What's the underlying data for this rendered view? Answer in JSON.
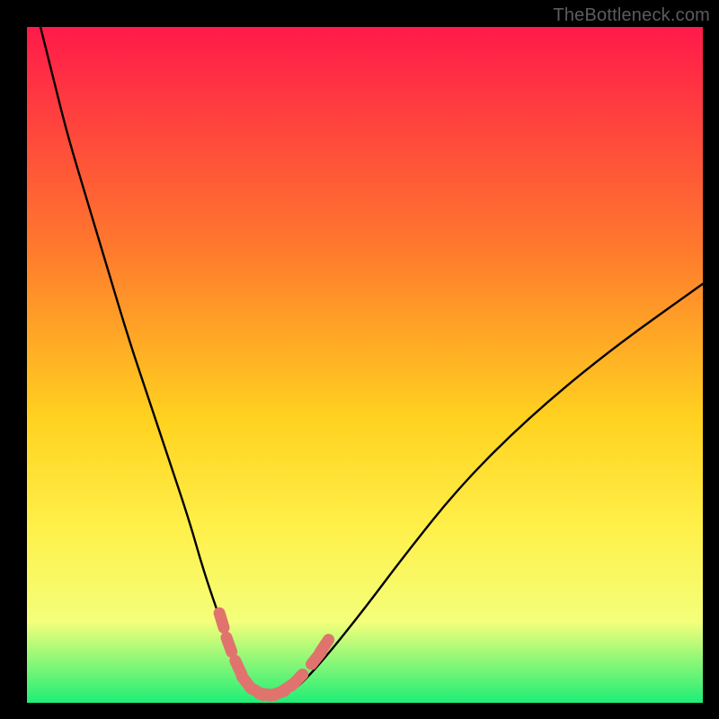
{
  "watermark": "TheBottleneck.com",
  "colors": {
    "frame": "#000000",
    "gradient_top": "#ff1a4a",
    "gradient_mid1": "#ff7a2d",
    "gradient_mid2": "#ffd21f",
    "gradient_mid3": "#fff04a",
    "gradient_mid4": "#f4ff7a",
    "gradient_bottom": "#1eee76",
    "curve": "#000000",
    "marker_fill": "#e0736e",
    "marker_stroke": "#c85a56"
  },
  "chart_data": {
    "type": "line",
    "title": "",
    "xlabel": "",
    "ylabel": "",
    "xlim": [
      0,
      100
    ],
    "ylim": [
      0,
      100
    ],
    "series": [
      {
        "name": "bottleneck-curve",
        "x": [
          2,
          4,
          6,
          9,
          12,
          15,
          18,
          21,
          24,
          26,
          28,
          30,
          31.5,
          33,
          34.5,
          36,
          38,
          40,
          44,
          50,
          56,
          64,
          74,
          86,
          100
        ],
        "y": [
          100,
          92,
          84,
          74,
          64,
          54,
          45,
          36,
          27,
          20,
          14,
          8.5,
          5,
          2.6,
          1.4,
          1.2,
          1.3,
          2.2,
          6.5,
          14,
          22,
          32,
          42,
          52,
          62
        ]
      }
    ],
    "markers": [
      {
        "x": 28.8,
        "y": 12.2
      },
      {
        "x": 29.9,
        "y": 8.6
      },
      {
        "x": 31.3,
        "y": 5.2
      },
      {
        "x": 32.5,
        "y": 3.0
      },
      {
        "x": 34.0,
        "y": 1.7
      },
      {
        "x": 35.5,
        "y": 1.25
      },
      {
        "x": 37.0,
        "y": 1.4
      },
      {
        "x": 38.5,
        "y": 2.2
      },
      {
        "x": 40.0,
        "y": 3.4
      },
      {
        "x": 42.8,
        "y": 6.6
      },
      {
        "x": 44.0,
        "y": 8.4
      }
    ],
    "gradient_stops": [
      {
        "offset": 0.0,
        "color_key": "gradient_top"
      },
      {
        "offset": 0.33,
        "color_key": "gradient_mid1"
      },
      {
        "offset": 0.58,
        "color_key": "gradient_mid2"
      },
      {
        "offset": 0.74,
        "color_key": "gradient_mid3"
      },
      {
        "offset": 0.88,
        "color_key": "gradient_mid4"
      },
      {
        "offset": 1.0,
        "color_key": "gradient_bottom"
      }
    ]
  }
}
